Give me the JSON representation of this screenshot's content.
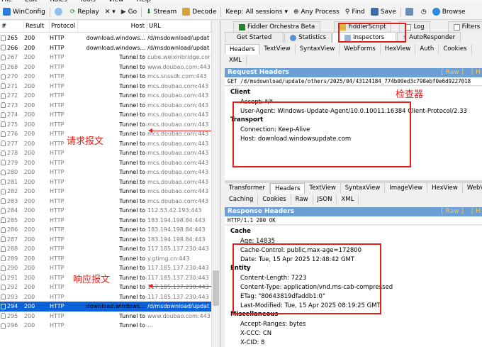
{
  "menu": [
    "File",
    "Edit",
    "Rules",
    "Tools",
    "View",
    "Help"
  ],
  "toolbar": {
    "winconfig": "WinConfig",
    "replay": "Replay",
    "cancel": "✕ ▾",
    "go": "Go",
    "stream": "Stream",
    "decode": "Decode",
    "keep": "Keep: All sessions ▾",
    "any_process": "Any Process",
    "find": "Find",
    "save": "Save",
    "browse": "Browse"
  },
  "sessions": {
    "columns": [
      "#",
      "Result",
      "Protocol",
      "Host",
      "URL"
    ],
    "rows": [
      {
        "num": "265",
        "result": "200",
        "protocol": "HTTP",
        "host": "download.windows...",
        "url": "/d/msdownload/updat",
        "tunnel": false
      },
      {
        "num": "266",
        "result": "200",
        "protocol": "HTTP",
        "host": "download.windows...",
        "url": "/d/msdownload/updat",
        "tunnel": false
      },
      {
        "num": "267",
        "result": "200",
        "protocol": "HTTP",
        "host": "Tunnel to",
        "url": "cube.weixinbridge.cor",
        "tunnel": true
      },
      {
        "num": "268",
        "result": "200",
        "protocol": "HTTP",
        "host": "Tunnel to",
        "url": "www.doubao.com:443",
        "tunnel": true
      },
      {
        "num": "270",
        "result": "200",
        "protocol": "HTTP",
        "host": "Tunnel to",
        "url": "mcs.snssdk.com:443",
        "tunnel": true
      },
      {
        "num": "271",
        "result": "200",
        "protocol": "HTTP",
        "host": "Tunnel to",
        "url": "mcs.doubao.com:443",
        "tunnel": true
      },
      {
        "num": "272",
        "result": "200",
        "protocol": "HTTP",
        "host": "Tunnel to",
        "url": "mcs.doubao.com:443",
        "tunnel": true
      },
      {
        "num": "273",
        "result": "200",
        "protocol": "HTTP",
        "host": "Tunnel to",
        "url": "mcs.doubao.com:443",
        "tunnel": true
      },
      {
        "num": "274",
        "result": "200",
        "protocol": "HTTP",
        "host": "Tunnel to",
        "url": "mcs.doubao.com:443",
        "tunnel": true
      },
      {
        "num": "275",
        "result": "200",
        "protocol": "HTTP",
        "host": "Tunnel to",
        "url": "mcs.doubao.com:443",
        "tunnel": true
      },
      {
        "num": "276",
        "result": "200",
        "protocol": "HTTP",
        "host": "Tunnel to",
        "url": "mcs.doubao.com:443",
        "tunnel": true
      },
      {
        "num": "277",
        "result": "200",
        "protocol": "HTTP",
        "host": "Tunnel to",
        "url": "mcs.doubao.com:443",
        "tunnel": true
      },
      {
        "num": "278",
        "result": "200",
        "protocol": "HTTP",
        "host": "Tunnel to",
        "url": "mcs.doubao.com:443",
        "tunnel": true
      },
      {
        "num": "279",
        "result": "200",
        "protocol": "HTTP",
        "host": "Tunnel to",
        "url": "mcs.doubao.com:443",
        "tunnel": true
      },
      {
        "num": "280",
        "result": "200",
        "protocol": "HTTP",
        "host": "Tunnel to",
        "url": "mcs.doubao.com:443",
        "tunnel": true
      },
      {
        "num": "281",
        "result": "200",
        "protocol": "HTTP",
        "host": "Tunnel to",
        "url": "mcs.doubao.com:443",
        "tunnel": true
      },
      {
        "num": "282",
        "result": "200",
        "protocol": "HTTP",
        "host": "Tunnel to",
        "url": "mcs.doubao.com:443",
        "tunnel": true
      },
      {
        "num": "283",
        "result": "200",
        "protocol": "HTTP",
        "host": "Tunnel to",
        "url": "mcs.doubao.com:443",
        "tunnel": true
      },
      {
        "num": "284",
        "result": "200",
        "protocol": "HTTP",
        "host": "Tunnel to",
        "url": "112.53.42.193:443",
        "tunnel": true
      },
      {
        "num": "285",
        "result": "200",
        "protocol": "HTTP",
        "host": "Tunnel to",
        "url": "183.194.198.84:443",
        "tunnel": true
      },
      {
        "num": "286",
        "result": "200",
        "protocol": "HTTP",
        "host": "Tunnel to",
        "url": "183.194.198.84:443",
        "tunnel": true
      },
      {
        "num": "287",
        "result": "200",
        "protocol": "HTTP",
        "host": "Tunnel to",
        "url": "183.194.198.84:443",
        "tunnel": true
      },
      {
        "num": "288",
        "result": "200",
        "protocol": "HTTP",
        "host": "Tunnel to",
        "url": "117.185.137.230:443",
        "tunnel": true
      },
      {
        "num": "289",
        "result": "200",
        "protocol": "HTTP",
        "host": "Tunnel to",
        "url": "y.gtimg.cn:443",
        "tunnel": true
      },
      {
        "num": "290",
        "result": "200",
        "protocol": "HTTP",
        "host": "Tunnel to",
        "url": "117.185.137.230:443",
        "tunnel": true
      },
      {
        "num": "291",
        "result": "200",
        "protocol": "HTTP",
        "host": "Tunnel to",
        "url": "117.185.137.230:443",
        "tunnel": true
      },
      {
        "num": "292",
        "result": "200",
        "protocol": "HTTP",
        "host": "Tunnel to",
        "url": "117.185.137.230:443",
        "tunnel": true
      },
      {
        "num": "293",
        "result": "200",
        "protocol": "HTTP",
        "host": "Tunnel to",
        "url": "117.185.137.230:443",
        "tunnel": true
      },
      {
        "num": "294",
        "result": "200",
        "protocol": "HTTP",
        "host": "download.windows...",
        "url": "/d/msdownload/updat",
        "tunnel": false,
        "selected": true
      },
      {
        "num": "295",
        "result": "200",
        "protocol": "HTTP",
        "host": "Tunnel to",
        "url": "www.doubao.com:443",
        "tunnel": true
      },
      {
        "num": "296",
        "result": "200",
        "protocol": "HTTP",
        "host": "Tunnel to",
        "url": "...",
        "tunnel": true
      }
    ]
  },
  "top_tabs": {
    "row1": [
      "Fiddler Orchestra Beta",
      "FiddlerScript",
      "Log",
      "Filters"
    ],
    "row2": [
      "Get Started",
      "Statistics",
      "Inspectors",
      "AutoResponder"
    ]
  },
  "request_tabs": [
    "Headers",
    "TextView",
    "SyntaxView",
    "WebForms",
    "HexView",
    "Auth",
    "Cookies"
  ],
  "request_tabs2": [
    "XML"
  ],
  "request": {
    "title": "Request Headers",
    "raw": "[ Raw ]",
    "line": "GET /d/msdownload/update/others/2025/04/43124184_774b00ed3c798ebf0e6d9227018",
    "groups": [
      {
        "name": "Client",
        "items": [
          "Accept: */*",
          "User-Agent: Windows-Update-Agent/10.0.10011.16384 Client-Protocol/2.33"
        ]
      },
      {
        "name": "Transport",
        "items": [
          "Connection: Keep-Alive",
          "Host: download.windowsupdate.com"
        ]
      }
    ]
  },
  "response_tabs": [
    "Transformer",
    "Headers",
    "TextView",
    "SyntaxView",
    "ImageView",
    "HexView",
    "WebV"
  ],
  "response_tabs2": [
    "Caching",
    "Cookies",
    "Raw",
    "JSON",
    "XML"
  ],
  "response": {
    "title": "Response Headers",
    "raw": "[ Raw ]",
    "line": "HTTP/1.1 200 OK",
    "groups": [
      {
        "name": "Cache",
        "items": [
          "Age: 14835",
          "Cache-Control: public,max-age=172800",
          "Date: Tue, 15 Apr 2025 12:48:42 GMT"
        ]
      },
      {
        "name": "Entity",
        "items": [
          "Content-Length: 7223",
          "Content-Type: application/vnd.ms-cab-compressed",
          "ETag: \"80643819dfaddb1:0\"",
          "Last-Modified: Tue, 15 Apr 2025 08:19:25 GMT"
        ]
      },
      {
        "name": "Miscellaneous",
        "items": [
          "Accept-Ranges: bytes",
          "X-CCC: CN",
          "X-CID: 8"
        ]
      }
    ]
  },
  "annotations": {
    "request": "请求报文",
    "response": "响应报文",
    "inspector": "检查器"
  },
  "colors": {
    "selection": "#0a62d6",
    "header_bar": "#6b9fd5",
    "annotation": "#e0211a"
  }
}
